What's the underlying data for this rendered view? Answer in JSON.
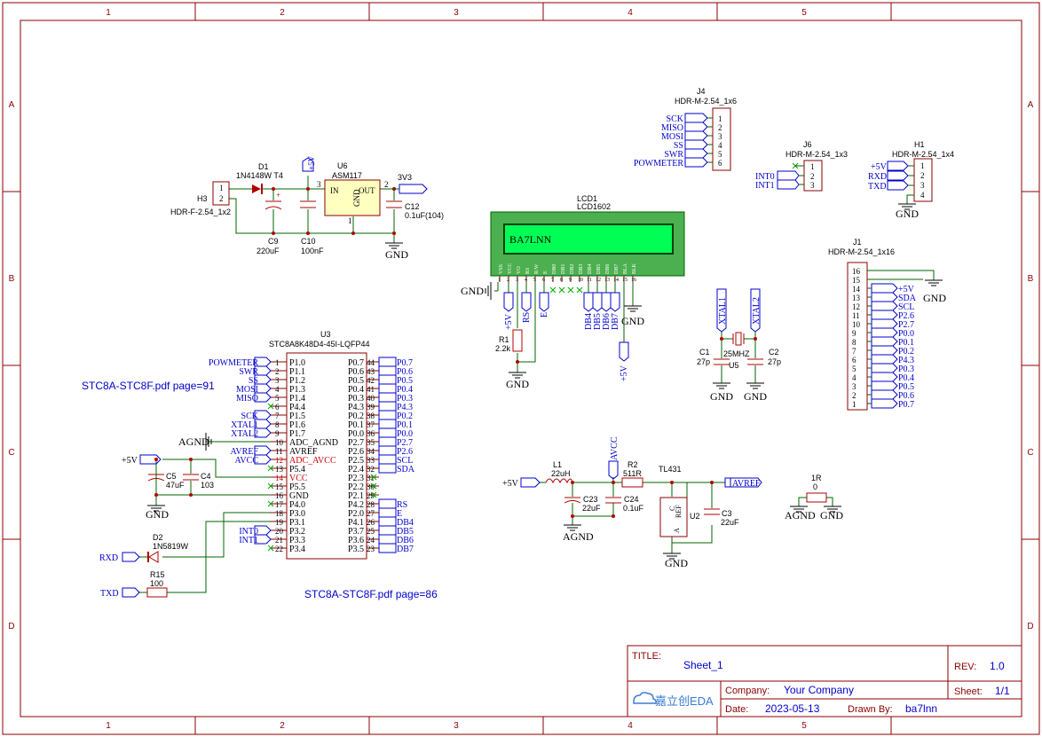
{
  "frame": {
    "cols": [
      "1",
      "2",
      "3",
      "4",
      "5"
    ],
    "rows": [
      "A",
      "B",
      "C",
      "D"
    ]
  },
  "notes": {
    "page91": "STC8A-STC8F.pdf page=91",
    "page86": "STC8A-STC8F.pdf page=86"
  },
  "title_block": {
    "title_label": "TITLE:",
    "title": "Sheet_1",
    "rev_label": "REV:",
    "rev": "1.0",
    "company_label": "Company:",
    "company": "Your Company",
    "sheet_label": "Sheet:",
    "sheet": "1/1",
    "date_label": "Date:",
    "date": "2023-05-13",
    "drawn_label": "Drawn By:",
    "drawn_by": "ba7lnn",
    "logo": "嘉立创EDA"
  },
  "power": {
    "h3_ref": "H3",
    "h3_val": "HDR-F-2.54_1x2",
    "h3_p1": "1",
    "h3_p2": "2",
    "d1_ref": "D1",
    "d1_val": "1N4148W T4",
    "c9_ref": "C9",
    "c9_val": "220uF",
    "c10_ref": "C10",
    "c10_val": "100nF",
    "u6_ref": "U6",
    "u6_val": "ASM117",
    "u6_in": "IN",
    "u6_out": "OUT",
    "u6_gnd": "GND",
    "u6_p1": "1",
    "u6_p2": "2",
    "u6_p3": "3",
    "c12_ref": "C12",
    "c12_val": "0.1uF(104)",
    "net_5v": "+5V",
    "net_3v3": "3V3",
    "gnd": "GND"
  },
  "lcd": {
    "ref": "LCD1",
    "val": "LCD1602",
    "screen_text": "BA7LNN",
    "pins": [
      "VSS",
      "VCC",
      "VO",
      "RS",
      "R/W",
      "E",
      "DB0",
      "DB1",
      "DB2",
      "DB3",
      "DB4",
      "DB5",
      "DB6",
      "DB7",
      "BLA",
      "BLK"
    ],
    "pin_nums": [
      "1",
      "2",
      "3",
      "4",
      "5",
      "6",
      "7",
      "8",
      "9",
      "10",
      "11",
      "12",
      "13",
      "14",
      "15",
      "16"
    ],
    "gnd": "GND",
    "p5v": "+5V",
    "rs": "RS",
    "e": "E",
    "db": [
      "DB4",
      "DB5",
      "DB6",
      "DB7"
    ],
    "r1_ref": "R1",
    "r1_val": "2.2k",
    "p5v_bl": "+5V",
    "gnd2": "GND"
  },
  "j4": {
    "ref": "J4",
    "val": "HDR-M-2.54_1x6",
    "nets": [
      "SCK",
      "MISO",
      "MOSI",
      "SS",
      "SWR",
      "POWMETER"
    ],
    "nums": [
      "1",
      "2",
      "3",
      "4",
      "5",
      "6"
    ]
  },
  "j6": {
    "ref": "J6",
    "val": "HDR-M-2.54_1x3",
    "nets": [
      "INT0",
      "INT1"
    ],
    "nums": [
      "1",
      "2",
      "3"
    ]
  },
  "h1": {
    "ref": "H1",
    "val": "HDR-M-2.54_1x4",
    "nets": [
      "+5V",
      "RXD",
      "TXD"
    ],
    "nums": [
      "1",
      "2",
      "3",
      "4"
    ],
    "gnd": "GND"
  },
  "j1": {
    "ref": "J1",
    "val": "HDR-M-2.54_1x16",
    "nums": [
      "16",
      "15",
      "14",
      "13",
      "12",
      "11",
      "10",
      "9",
      "8",
      "7",
      "6",
      "5",
      "4",
      "3",
      "2",
      "1"
    ],
    "nets": [
      "+5V",
      "SDA",
      "SCL",
      "P2.6",
      "P2.7",
      "P0.0",
      "P0.1",
      "P0.2",
      "P4.3",
      "P0.3",
      "P0.4",
      "P0.5",
      "P0.6",
      "P0.7"
    ],
    "gnd": "GND"
  },
  "xtal": {
    "xtal1": "XTAL1",
    "xtal2": "XTAL2",
    "c1_ref": "C1",
    "c1_val": "27p",
    "c2_ref": "C2",
    "c2_val": "27p",
    "y_val": "25MHZ",
    "y_ref": "U5",
    "gnd": "GND"
  },
  "mcu": {
    "ref": "U3",
    "val": "STC8A8K48D4-45I-LQFP44",
    "left_pins": [
      {
        "num": "1",
        "name": "P1.0",
        "net": "POWMETER"
      },
      {
        "num": "2",
        "name": "P1.1",
        "net": "SWR"
      },
      {
        "num": "3",
        "name": "P1.2",
        "net": "SS"
      },
      {
        "num": "4",
        "name": "P1.3",
        "net": "MOSI"
      },
      {
        "num": "5",
        "name": "P1.4",
        "net": "MISO"
      },
      {
        "num": "6",
        "name": "P4.4",
        "net": ""
      },
      {
        "num": "7",
        "name": "P1.5",
        "net": "SCK"
      },
      {
        "num": "8",
        "name": "P1.6",
        "net": "XTAL1"
      },
      {
        "num": "9",
        "name": "P1.7",
        "net": "XTAL2"
      },
      {
        "num": "10",
        "name": "ADC_AGND",
        "net": "AGND"
      },
      {
        "num": "11",
        "name": "AVREF",
        "net": "AVREF"
      },
      {
        "num": "12",
        "name": "ADC_AVCC",
        "net": "AVCC"
      },
      {
        "num": "13",
        "name": "P5.4",
        "net": ""
      },
      {
        "num": "14",
        "name": "VCC",
        "net": ""
      },
      {
        "num": "15",
        "name": "P5.5",
        "net": ""
      },
      {
        "num": "16",
        "name": "GND",
        "net": ""
      },
      {
        "num": "17",
        "name": "P4.0",
        "net": ""
      },
      {
        "num": "18",
        "name": "P3.0",
        "net": ""
      },
      {
        "num": "19",
        "name": "P3.1",
        "net": ""
      },
      {
        "num": "20",
        "name": "P3.2",
        "net": "INT0"
      },
      {
        "num": "21",
        "name": "P3.3",
        "net": "INT1"
      },
      {
        "num": "22",
        "name": "P3.4",
        "net": ""
      }
    ],
    "right_pins": [
      {
        "num": "44",
        "name": "P0.7",
        "net": "P0.7"
      },
      {
        "num": "43",
        "name": "P0.6",
        "net": "P0.6"
      },
      {
        "num": "42",
        "name": "P0.5",
        "net": "P0.5"
      },
      {
        "num": "41",
        "name": "P0.4",
        "net": "P0.4"
      },
      {
        "num": "40",
        "name": "P0.3",
        "net": "P0.3"
      },
      {
        "num": "39",
        "name": "P4.3",
        "net": "P4.3"
      },
      {
        "num": "38",
        "name": "P0.2",
        "net": "P0.2"
      },
      {
        "num": "37",
        "name": "P0.1",
        "net": "P0.1"
      },
      {
        "num": "36",
        "name": "P0.0",
        "net": "P0.0"
      },
      {
        "num": "35",
        "name": "P2.7",
        "net": "P2.7"
      },
      {
        "num": "34",
        "name": "P2.6",
        "net": "P2.6"
      },
      {
        "num": "33",
        "name": "P2.5",
        "net": "SCL"
      },
      {
        "num": "32",
        "name": "P2.4",
        "net": "SDA"
      },
      {
        "num": "31",
        "name": "P2.3",
        "net": ""
      },
      {
        "num": "30",
        "name": "P2.2",
        "net": ""
      },
      {
        "num": "29",
        "name": "P2.1",
        "net": ""
      },
      {
        "num": "28",
        "name": "P4.2",
        "net": "RS"
      },
      {
        "num": "27",
        "name": "P2.0",
        "net": "E"
      },
      {
        "num": "26",
        "name": "P4.1",
        "net": "DB4"
      },
      {
        "num": "25",
        "name": "P3.7",
        "net": "DB5"
      },
      {
        "num": "24",
        "name": "P3.6",
        "net": "DB6"
      },
      {
        "num": "23",
        "name": "P3.5",
        "net": "DB7"
      }
    ],
    "p5v": "+5V",
    "c5_ref": "C5",
    "c5_val": "47uF",
    "c4_ref": "C4",
    "c4_val": "103",
    "gnd": "GND",
    "d2_ref": "D2",
    "d2_val": "1N5819W",
    "rxd": "RXD",
    "txd": "TXD",
    "r15_ref": "R15",
    "r15_val": "100"
  },
  "analog": {
    "p5v": "+5V",
    "l1_ref": "L1",
    "l1_val": "22uH",
    "avcc": "AVCC",
    "r2_ref": "R2",
    "r2_val": "511R",
    "u2_name": "TL431",
    "avref": "AVREF",
    "c23_ref": "C23",
    "c23_val": "22uF",
    "c24_ref": "C24",
    "c24_val": "0.1uF",
    "c3_ref": "C3",
    "c3_val": "22uF",
    "u2_ref": "U2",
    "u2_c": "C",
    "u2_ref_pin": "REF",
    "u2_a": "A",
    "agnd": "AGND",
    "gnd": "GND",
    "r1r_ref": "1R",
    "r1r_val": "0",
    "agnd2": "AGND",
    "gnd3": "GND"
  }
}
